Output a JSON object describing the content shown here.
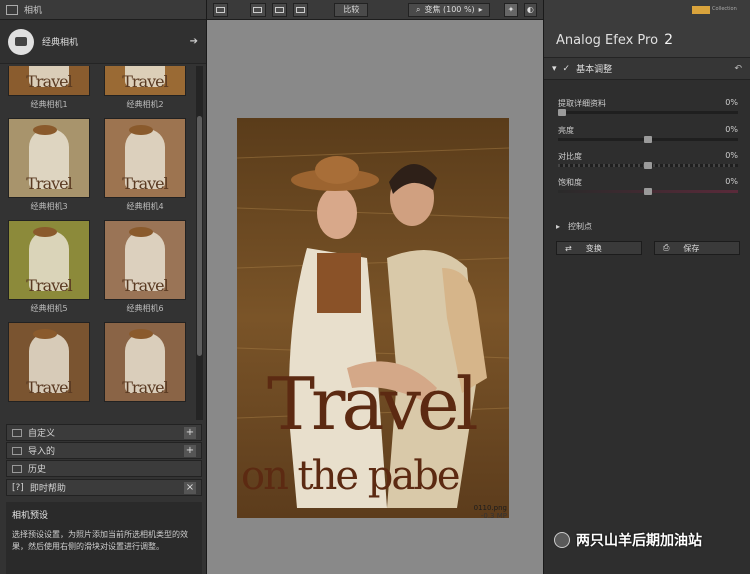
{
  "left": {
    "title": "相机",
    "preset_header": "经典相机",
    "thumbs": [
      {
        "label": "经典相机1",
        "tone": "#8a5c2e"
      },
      {
        "label": "经典相机2",
        "tone": "#9a6a34"
      },
      {
        "label": "经典相机3",
        "tone": "#a8946c"
      },
      {
        "label": "经典相机4",
        "tone": "#9d7450"
      },
      {
        "label": "经典相机5",
        "tone": "#8c8a3a"
      },
      {
        "label": "经典相机6",
        "tone": "#9a7456"
      },
      {
        "label": "",
        "tone": "#7a5430"
      },
      {
        "label": "",
        "tone": "#8a6446"
      }
    ],
    "thumb_word": "Travel",
    "sections": {
      "custom": "自定义",
      "import": "导入的",
      "history": "历史",
      "help": "即时帮助"
    },
    "help_title": "相机预设",
    "help_text": "选择预设设置，为照片添加当前所选相机类型的效果，然后使用右侧的滑块对设置进行调整。"
  },
  "toolbar": {
    "compare": "比较",
    "zoom": "变焦 (100 %)"
  },
  "canvas": {
    "file_name": "0110.png",
    "file_size": "-0.3 MP",
    "photo_text_1": "Travel",
    "photo_text_2": "on the pabe"
  },
  "right": {
    "app_name": "Analog Efex Pro",
    "version": "2",
    "collection": "Collection",
    "section": "基本调整",
    "sliders": [
      {
        "label": "提取详细资料",
        "value": "0%",
        "level": 0
      },
      {
        "label": "亮度",
        "value": "0%",
        "level": 0.5
      },
      {
        "label": "对比度",
        "value": "0%",
        "level": 0.5
      },
      {
        "label": "饱和度",
        "value": "0%",
        "level": 0.5
      }
    ],
    "control_points": "控制点",
    "swap": "变换",
    "save": "保存"
  },
  "watermark": "两只山羊后期加油站",
  "colors": {
    "panel": "#333333",
    "canvas": "#898989",
    "accent": "#d9a33c"
  }
}
